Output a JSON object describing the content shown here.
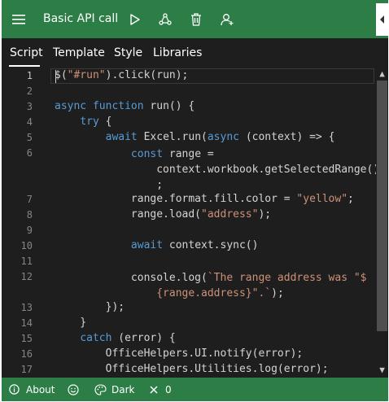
{
  "header": {
    "title": "Basic API call",
    "icons": [
      "hamburger-menu-icon",
      "run-icon",
      "share-icon",
      "delete-icon",
      "account-icon"
    ],
    "accent_color": "#2d7d46"
  },
  "tabs": [
    {
      "label": "Script",
      "selected": true
    },
    {
      "label": "Template",
      "selected": false
    },
    {
      "label": "Style",
      "selected": false
    },
    {
      "label": "Libraries",
      "selected": false
    }
  ],
  "editor": {
    "lines": [
      {
        "n": "1",
        "text": "$(\"#run\").click(run);"
      },
      {
        "n": "2",
        "text": ""
      },
      {
        "n": "3",
        "text": "async function run() {"
      },
      {
        "n": "4",
        "text": "    try {"
      },
      {
        "n": "5",
        "text": "        await Excel.run(async (context) => {"
      },
      {
        "n": "6",
        "text": "            const range = context.workbook.getSelectedRange();"
      },
      {
        "n": "7",
        "text": "            range.format.fill.color = \"yellow\";"
      },
      {
        "n": "8",
        "text": "            range.load(\"address\");"
      },
      {
        "n": "9",
        "text": ""
      },
      {
        "n": "10",
        "text": "            await context.sync()"
      },
      {
        "n": "11",
        "text": ""
      },
      {
        "n": "12",
        "text": "            console.log(`The range address was \"${range.address}\".`);"
      },
      {
        "n": "13",
        "text": "        });"
      },
      {
        "n": "14",
        "text": "    }"
      },
      {
        "n": "15",
        "text": "    catch (error) {"
      },
      {
        "n": "16",
        "text": "        OfficeHelpers.UI.notify(error);"
      },
      {
        "n": "17",
        "text": "        OfficeHelpers.Utilities.log(error);"
      }
    ],
    "active_line": 1
  },
  "status": {
    "about_label": "About",
    "theme_label": "Dark",
    "error_count": "0",
    "icons": [
      "info-icon",
      "smiley-feedback-icon",
      "palette-icon",
      "error-icon"
    ]
  }
}
